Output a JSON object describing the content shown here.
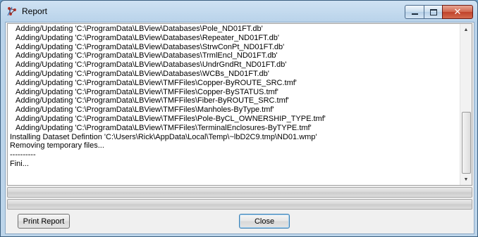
{
  "window": {
    "title": "Report",
    "controls": {
      "minimize": "minimize-icon",
      "maximize": "maximize-icon",
      "close": "close-icon",
      "close_glyph": "✕"
    }
  },
  "log": {
    "lines": [
      {
        "text": "Adding/Updating 'C:\\ProgramData\\LBView\\Databases\\Pole_ND01FT.db'",
        "indent": true
      },
      {
        "text": "Adding/Updating 'C:\\ProgramData\\LBView\\Databases\\Repeater_ND01FT.db'",
        "indent": true
      },
      {
        "text": "Adding/Updating 'C:\\ProgramData\\LBView\\Databases\\StrwConPt_ND01FT.db'",
        "indent": true
      },
      {
        "text": "Adding/Updating 'C:\\ProgramData\\LBView\\Databases\\TrmlEncl_ND01FT.db'",
        "indent": true
      },
      {
        "text": "Adding/Updating 'C:\\ProgramData\\LBView\\Databases\\UndrGndRt_ND01FT.db'",
        "indent": true
      },
      {
        "text": "Adding/Updating 'C:\\ProgramData\\LBView\\Databases\\WCBs_ND01FT.db'",
        "indent": true
      },
      {
        "text": "Adding/Updating 'C:\\ProgramData\\LBView\\TMFFiles\\Copper-ByROUTE_SRC.tmf'",
        "indent": true
      },
      {
        "text": "Adding/Updating 'C:\\ProgramData\\LBView\\TMFFiles\\Copper-BySTATUS.tmf'",
        "indent": true
      },
      {
        "text": "Adding/Updating 'C:\\ProgramData\\LBView\\TMFFiles\\Fiber-ByROUTE_SRC.tmf'",
        "indent": true
      },
      {
        "text": "Adding/Updating 'C:\\ProgramData\\LBView\\TMFFiles\\Manholes-ByType.tmf'",
        "indent": true
      },
      {
        "text": "Adding/Updating 'C:\\ProgramData\\LBView\\TMFFiles\\Pole-ByCL_OWNERSHIP_TYPE.tmf'",
        "indent": true
      },
      {
        "text": "Adding/Updating 'C:\\ProgramData\\LBView\\TMFFiles\\TerminalEnclosures-ByTYPE.tmf'",
        "indent": true
      },
      {
        "text": "Installing Dataset Defintion 'C:\\Users\\Rick\\AppData\\Local\\Temp\\~lbD2C9.tmp\\ND01.wmp'",
        "indent": false
      },
      {
        "text": "Removing temporary files...",
        "indent": false
      },
      {
        "text": "----------",
        "indent": false
      },
      {
        "text": "Fini...",
        "indent": false
      }
    ],
    "scrollbar": {
      "up_glyph": "▲",
      "down_glyph": "▼"
    }
  },
  "progress_bars": [
    {
      "name": "progress-bar-1",
      "fraction": 0
    },
    {
      "name": "progress-bar-2",
      "fraction": 0
    }
  ],
  "buttons": {
    "print_report": "Print Report",
    "close": "Close"
  }
}
